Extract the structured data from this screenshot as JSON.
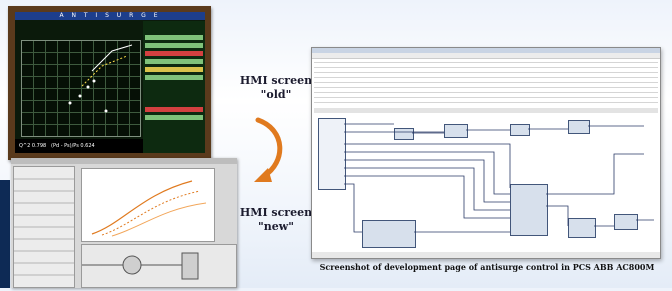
{
  "labels": {
    "old_title": "HMI screen",
    "old_sub": "\"old\"",
    "new_title": "HMI screen",
    "new_sub": "\"new\""
  },
  "caption": "Screenshot of development page of antisurge control in PCS ABB AC800M",
  "old_hmi": {
    "title": "A N T I S U R G E",
    "bottom_left": "Q^2 0.798",
    "bottom_right": "(Pd - Ps)/Ps 0.624"
  },
  "colors": {
    "old_bg": "#0b1a0b",
    "old_title_bar": "#1d3e8c",
    "brown_frame": "#5a3a1c",
    "arrow": "#e07a1f"
  }
}
